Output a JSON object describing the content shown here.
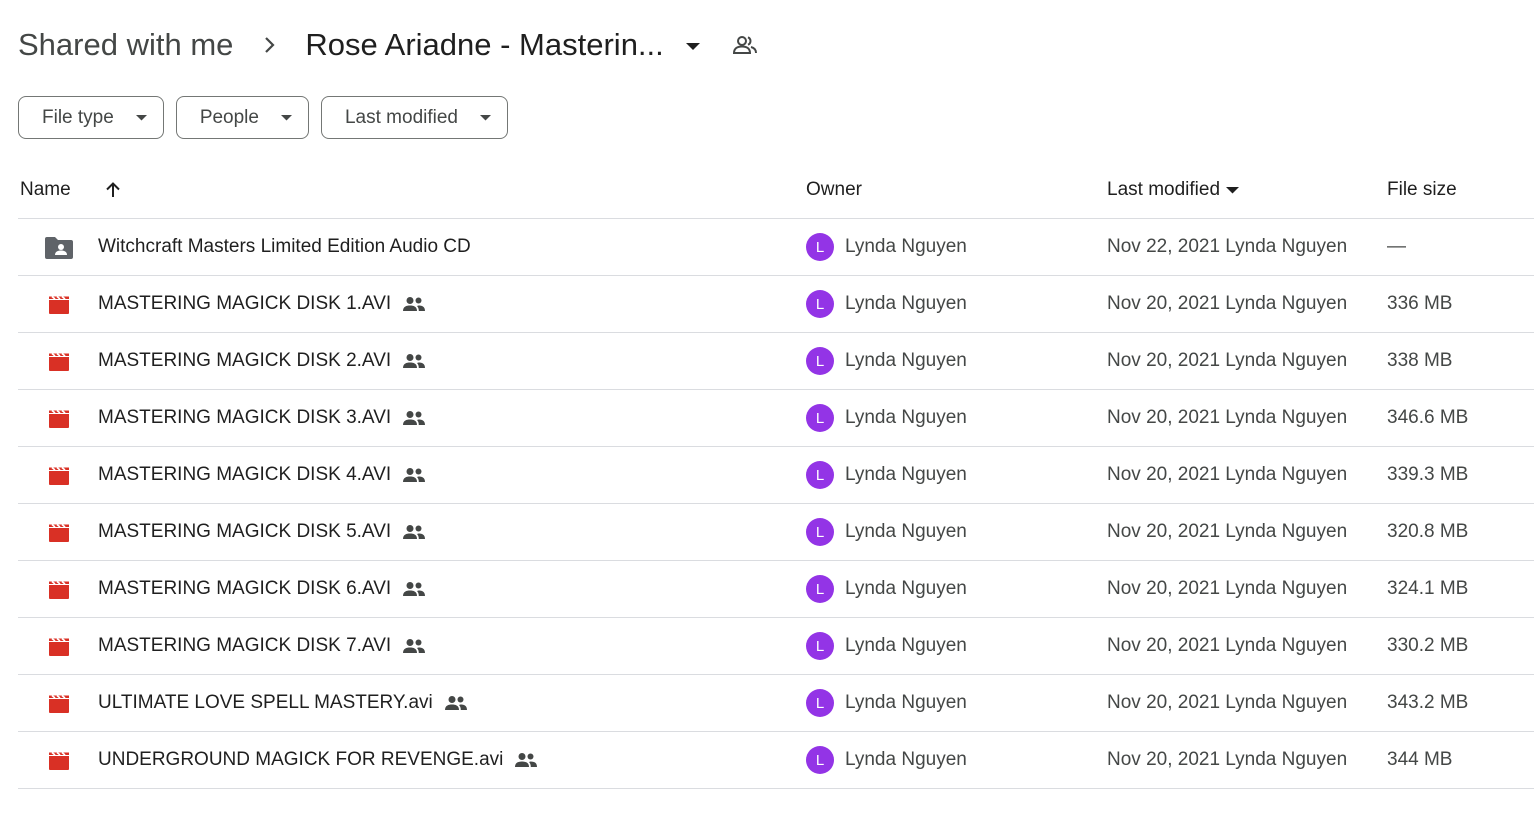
{
  "breadcrumb": {
    "root": "Shared with me",
    "separator": "›",
    "current": "Rose Ariadne - Masterin..."
  },
  "filters": [
    {
      "label": "File type"
    },
    {
      "label": "People"
    },
    {
      "label": "Last modified"
    }
  ],
  "table": {
    "headers": {
      "name": "Name",
      "owner": "Owner",
      "last_modified": "Last modified",
      "file_size": "File size"
    },
    "rows": [
      {
        "type": "shared-folder",
        "name": "Witchcraft Masters Limited Edition Audio CD",
        "shared": false,
        "owner_initial": "L",
        "owner": "Lynda Nguyen",
        "modified": "Nov 22, 2021 Lynda Nguyen",
        "size": "—"
      },
      {
        "type": "video",
        "name": "MASTERING MAGICK DISK 1.AVI",
        "shared": true,
        "owner_initial": "L",
        "owner": "Lynda Nguyen",
        "modified": "Nov 20, 2021 Lynda Nguyen",
        "size": "336 MB"
      },
      {
        "type": "video",
        "name": "MASTERING MAGICK DISK 2.AVI",
        "shared": true,
        "owner_initial": "L",
        "owner": "Lynda Nguyen",
        "modified": "Nov 20, 2021 Lynda Nguyen",
        "size": "338 MB"
      },
      {
        "type": "video",
        "name": "MASTERING MAGICK DISK 3.AVI",
        "shared": true,
        "owner_initial": "L",
        "owner": "Lynda Nguyen",
        "modified": "Nov 20, 2021 Lynda Nguyen",
        "size": "346.6 MB"
      },
      {
        "type": "video",
        "name": "MASTERING MAGICK DISK 4.AVI",
        "shared": true,
        "owner_initial": "L",
        "owner": "Lynda Nguyen",
        "modified": "Nov 20, 2021 Lynda Nguyen",
        "size": "339.3 MB"
      },
      {
        "type": "video",
        "name": "MASTERING MAGICK DISK 5.AVI",
        "shared": true,
        "owner_initial": "L",
        "owner": "Lynda Nguyen",
        "modified": "Nov 20, 2021 Lynda Nguyen",
        "size": "320.8 MB"
      },
      {
        "type": "video",
        "name": "MASTERING MAGICK DISK 6.AVI",
        "shared": true,
        "owner_initial": "L",
        "owner": "Lynda Nguyen",
        "modified": "Nov 20, 2021 Lynda Nguyen",
        "size": "324.1 MB"
      },
      {
        "type": "video",
        "name": "MASTERING MAGICK DISK 7.AVI",
        "shared": true,
        "owner_initial": "L",
        "owner": "Lynda Nguyen",
        "modified": "Nov 20, 2021 Lynda Nguyen",
        "size": "330.2 MB"
      },
      {
        "type": "video",
        "name": "ULTIMATE LOVE SPELL MASTERY.avi",
        "shared": true,
        "owner_initial": "L",
        "owner": "Lynda Nguyen",
        "modified": "Nov 20, 2021 Lynda Nguyen",
        "size": "343.2 MB"
      },
      {
        "type": "video",
        "name": "UNDERGROUND MAGICK FOR REVENGE.avi",
        "shared": true,
        "owner_initial": "L",
        "owner": "Lynda Nguyen",
        "modified": "Nov 20, 2021 Lynda Nguyen",
        "size": "344 MB"
      }
    ]
  },
  "colors": {
    "video_icon": "#d93025",
    "folder_icon": "#5f6368",
    "avatar_bg": "#9334e6"
  },
  "icons": {
    "breadcrumb_people": "people-outline-icon",
    "sort": "arrow-up-icon",
    "video": "video-file-icon",
    "shared_folder": "shared-folder-icon",
    "shared": "people-icon"
  }
}
